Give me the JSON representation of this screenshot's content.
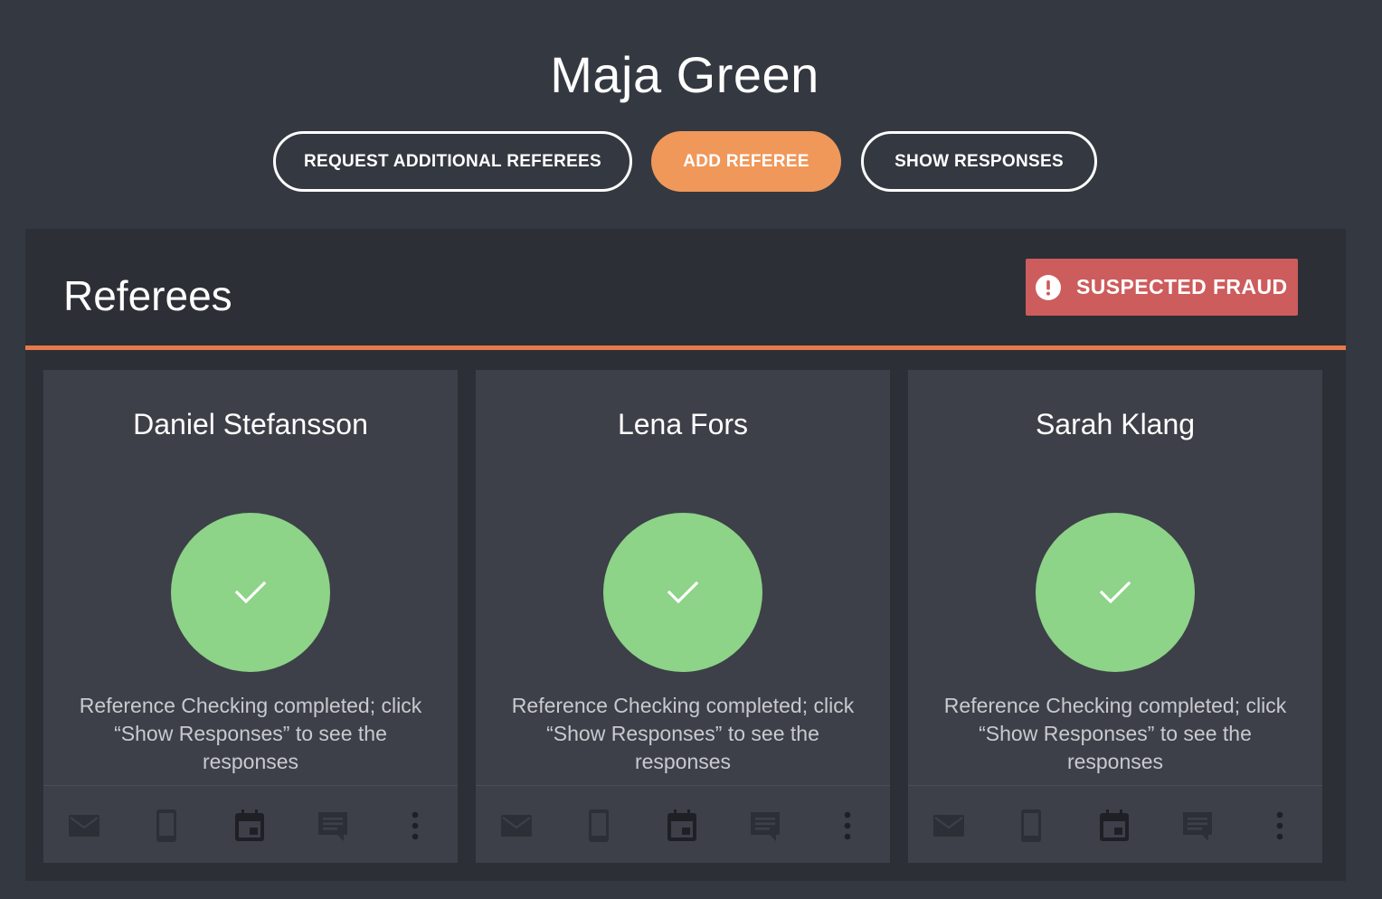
{
  "candidate": {
    "name": "Maja Green"
  },
  "actions": {
    "request_additional": "REQUEST ADDITIONAL REFEREES",
    "add_referee": "ADD REFEREE",
    "show_responses": "SHOW RESPONSES"
  },
  "panel": {
    "title": "Referees",
    "fraud_badge": {
      "label": "SUSPECTED FRAUD",
      "icon": "exclamation-circle-icon"
    }
  },
  "referees": [
    {
      "name": "Daniel Stefansson",
      "status": "Reference Checking completed; click “Show Responses” to see the responses"
    },
    {
      "name": "Lena Fors",
      "status": "Reference Checking completed; click “Show Responses” to see the responses"
    },
    {
      "name": "Sarah Klang",
      "status": "Reference Checking completed; click “Show Responses” to see the responses"
    }
  ],
  "footer_icons": [
    "mail-icon",
    "phone-icon",
    "calendar-icon",
    "message-icon",
    "more-vertical-icon"
  ],
  "colors": {
    "background": "#343841",
    "panel": "#2c2f36",
    "card": "#3d4048",
    "accent": "#f0985a",
    "divider": "#e8794a",
    "fraud": "#cd5c5c",
    "success": "#8dd388"
  }
}
